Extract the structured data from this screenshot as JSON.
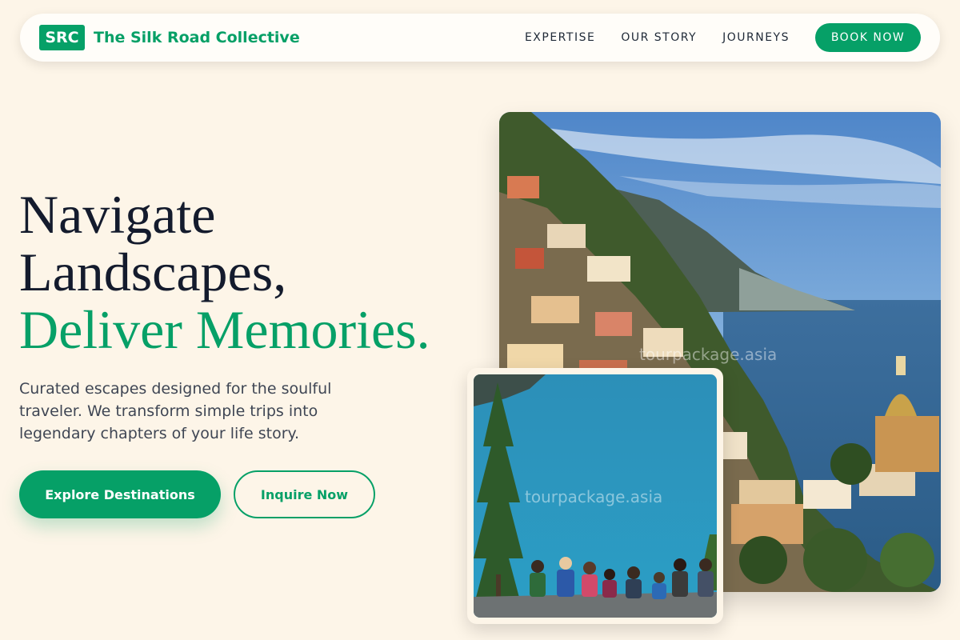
{
  "nav": {
    "logo_badge": "SRC",
    "brand_name": "The Silk Road Collective",
    "links": [
      "EXPERTISE",
      "OUR STORY",
      "JOURNEYS"
    ],
    "cta": "BOOK NOW"
  },
  "hero": {
    "headline_line1": "Navigate",
    "headline_line2": "Landscapes,",
    "headline_accent": "Deliver Memories.",
    "subtitle": "Curated escapes designed for the soulful traveler. We transform simple trips into legendary chapters of your life story.",
    "primary_button": "Explore Destinations",
    "secondary_button": "Inquire Now"
  },
  "images": {
    "main_watermark": "tourpackage.asia",
    "secondary_watermark": "tourpackage.asia"
  },
  "colors": {
    "accent": "#06a067",
    "background": "#fdf5e8",
    "heading": "#141b2d"
  }
}
